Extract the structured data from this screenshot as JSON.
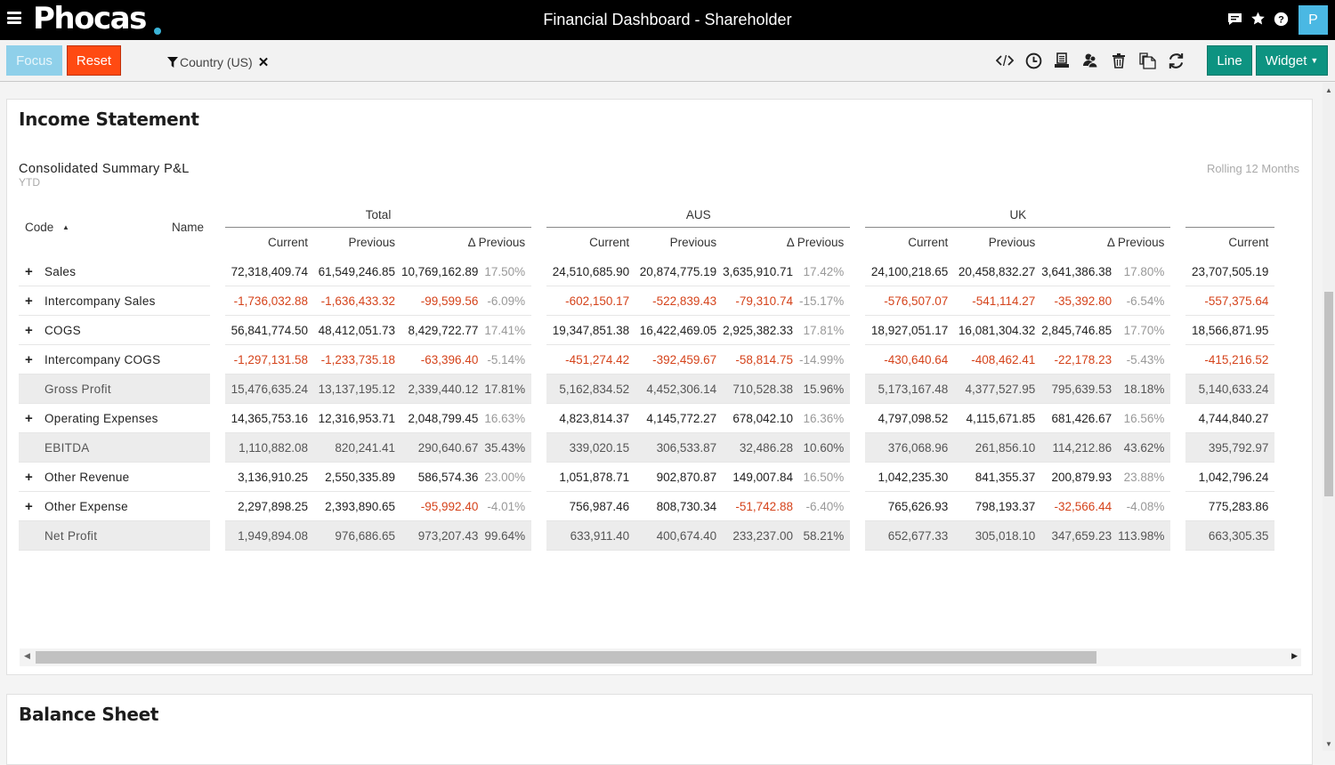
{
  "header": {
    "logo": "Phocas",
    "title": "Financial Dashboard - Shareholder",
    "avatar_initial": "P",
    "icons": [
      "chat-icon",
      "star-icon",
      "help-icon"
    ]
  },
  "toolbar": {
    "focus_label": "Focus",
    "reset_label": "Reset",
    "filter_label": "Country (US)",
    "tool_icons": [
      "code-icon",
      "clock-icon",
      "print-icon",
      "users-icon",
      "trash-icon",
      "copy-icon",
      "refresh-icon"
    ],
    "line_label": "Line",
    "widget_label": "Widget",
    "colors": {
      "focus": "#8fd0ea",
      "reset": "#ff4a12",
      "teal": "#0d9381"
    }
  },
  "income": {
    "title": "Income Statement",
    "subtitle": "Consolidated Summary P&L",
    "period": "YTD",
    "rolling": "Rolling 12 Months",
    "headers": {
      "code": "Code",
      "name": "Name",
      "groups": [
        "Total",
        "AUS",
        "UK"
      ],
      "current": "Current",
      "previous": "Previous",
      "delta_previous": "Δ Previous"
    },
    "rows": [
      {
        "label": "Sales",
        "expandable": true,
        "summary": false,
        "total": [
          "72,318,409.74",
          "61,549,246.85",
          "10,769,162.89",
          "17.50%"
        ],
        "aus": [
          "24,510,685.90",
          "20,874,775.19",
          "3,635,910.71",
          "17.42%"
        ],
        "uk": [
          "24,100,218.65",
          "20,458,832.27",
          "3,641,386.38",
          "17.80%"
        ],
        "next_current": "23,707,505.19"
      },
      {
        "label": "Intercompany Sales",
        "expandable": true,
        "summary": false,
        "total": [
          "-1,736,032.88",
          "-1,636,433.32",
          "-99,599.56",
          "-6.09%"
        ],
        "aus": [
          "-602,150.17",
          "-522,839.43",
          "-79,310.74",
          "-15.17%"
        ],
        "uk": [
          "-576,507.07",
          "-541,114.27",
          "-35,392.80",
          "-6.54%"
        ],
        "next_current": "-557,375.64"
      },
      {
        "label": "COGS",
        "expandable": true,
        "summary": false,
        "total": [
          "56,841,774.50",
          "48,412,051.73",
          "8,429,722.77",
          "17.41%"
        ],
        "aus": [
          "19,347,851.38",
          "16,422,469.05",
          "2,925,382.33",
          "17.81%"
        ],
        "uk": [
          "18,927,051.17",
          "16,081,304.32",
          "2,845,746.85",
          "17.70%"
        ],
        "next_current": "18,566,871.95"
      },
      {
        "label": "Intercompany COGS",
        "expandable": true,
        "summary": false,
        "total": [
          "-1,297,131.58",
          "-1,233,735.18",
          "-63,396.40",
          "-5.14%"
        ],
        "aus": [
          "-451,274.42",
          "-392,459.67",
          "-58,814.75",
          "-14.99%"
        ],
        "uk": [
          "-430,640.64",
          "-408,462.41",
          "-22,178.23",
          "-5.43%"
        ],
        "next_current": "-415,216.52"
      },
      {
        "label": "Gross Profit",
        "expandable": false,
        "summary": true,
        "total": [
          "15,476,635.24",
          "13,137,195.12",
          "2,339,440.12",
          "17.81%"
        ],
        "aus": [
          "5,162,834.52",
          "4,452,306.14",
          "710,528.38",
          "15.96%"
        ],
        "uk": [
          "5,173,167.48",
          "4,377,527.95",
          "795,639.53",
          "18.18%"
        ],
        "next_current": "5,140,633.24"
      },
      {
        "label": "Operating Expenses",
        "expandable": true,
        "summary": false,
        "total": [
          "14,365,753.16",
          "12,316,953.71",
          "2,048,799.45",
          "16.63%"
        ],
        "aus": [
          "4,823,814.37",
          "4,145,772.27",
          "678,042.10",
          "16.36%"
        ],
        "uk": [
          "4,797,098.52",
          "4,115,671.85",
          "681,426.67",
          "16.56%"
        ],
        "next_current": "4,744,840.27"
      },
      {
        "label": "EBITDA",
        "expandable": false,
        "summary": true,
        "total": [
          "1,110,882.08",
          "820,241.41",
          "290,640.67",
          "35.43%"
        ],
        "aus": [
          "339,020.15",
          "306,533.87",
          "32,486.28",
          "10.60%"
        ],
        "uk": [
          "376,068.96",
          "261,856.10",
          "114,212.86",
          "43.62%"
        ],
        "next_current": "395,792.97"
      },
      {
        "label": "Other Revenue",
        "expandable": true,
        "summary": false,
        "total": [
          "3,136,910.25",
          "2,550,335.89",
          "586,574.36",
          "23.00%"
        ],
        "aus": [
          "1,051,878.71",
          "902,870.87",
          "149,007.84",
          "16.50%"
        ],
        "uk": [
          "1,042,235.30",
          "841,355.37",
          "200,879.93",
          "23.88%"
        ],
        "next_current": "1,042,796.24"
      },
      {
        "label": "Other Expense",
        "expandable": true,
        "summary": false,
        "total": [
          "2,297,898.25",
          "2,393,890.65",
          "-95,992.40",
          "-4.01%"
        ],
        "aus": [
          "756,987.46",
          "808,730.34",
          "-51,742.88",
          "-6.40%"
        ],
        "uk": [
          "765,626.93",
          "798,193.37",
          "-32,566.44",
          "-4.08%"
        ],
        "next_current": "775,283.86"
      },
      {
        "label": "Net Profit",
        "expandable": false,
        "summary": true,
        "total": [
          "1,949,894.08",
          "976,686.65",
          "973,207.43",
          "99.64%"
        ],
        "aus": [
          "633,911.40",
          "400,674.40",
          "233,237.00",
          "58.21%"
        ],
        "uk": [
          "652,677.33",
          "305,018.10",
          "347,659.23",
          "113.98%"
        ],
        "next_current": "663,305.35"
      }
    ],
    "negative_color": "#d5431b"
  },
  "balance": {
    "title": "Balance Sheet"
  }
}
